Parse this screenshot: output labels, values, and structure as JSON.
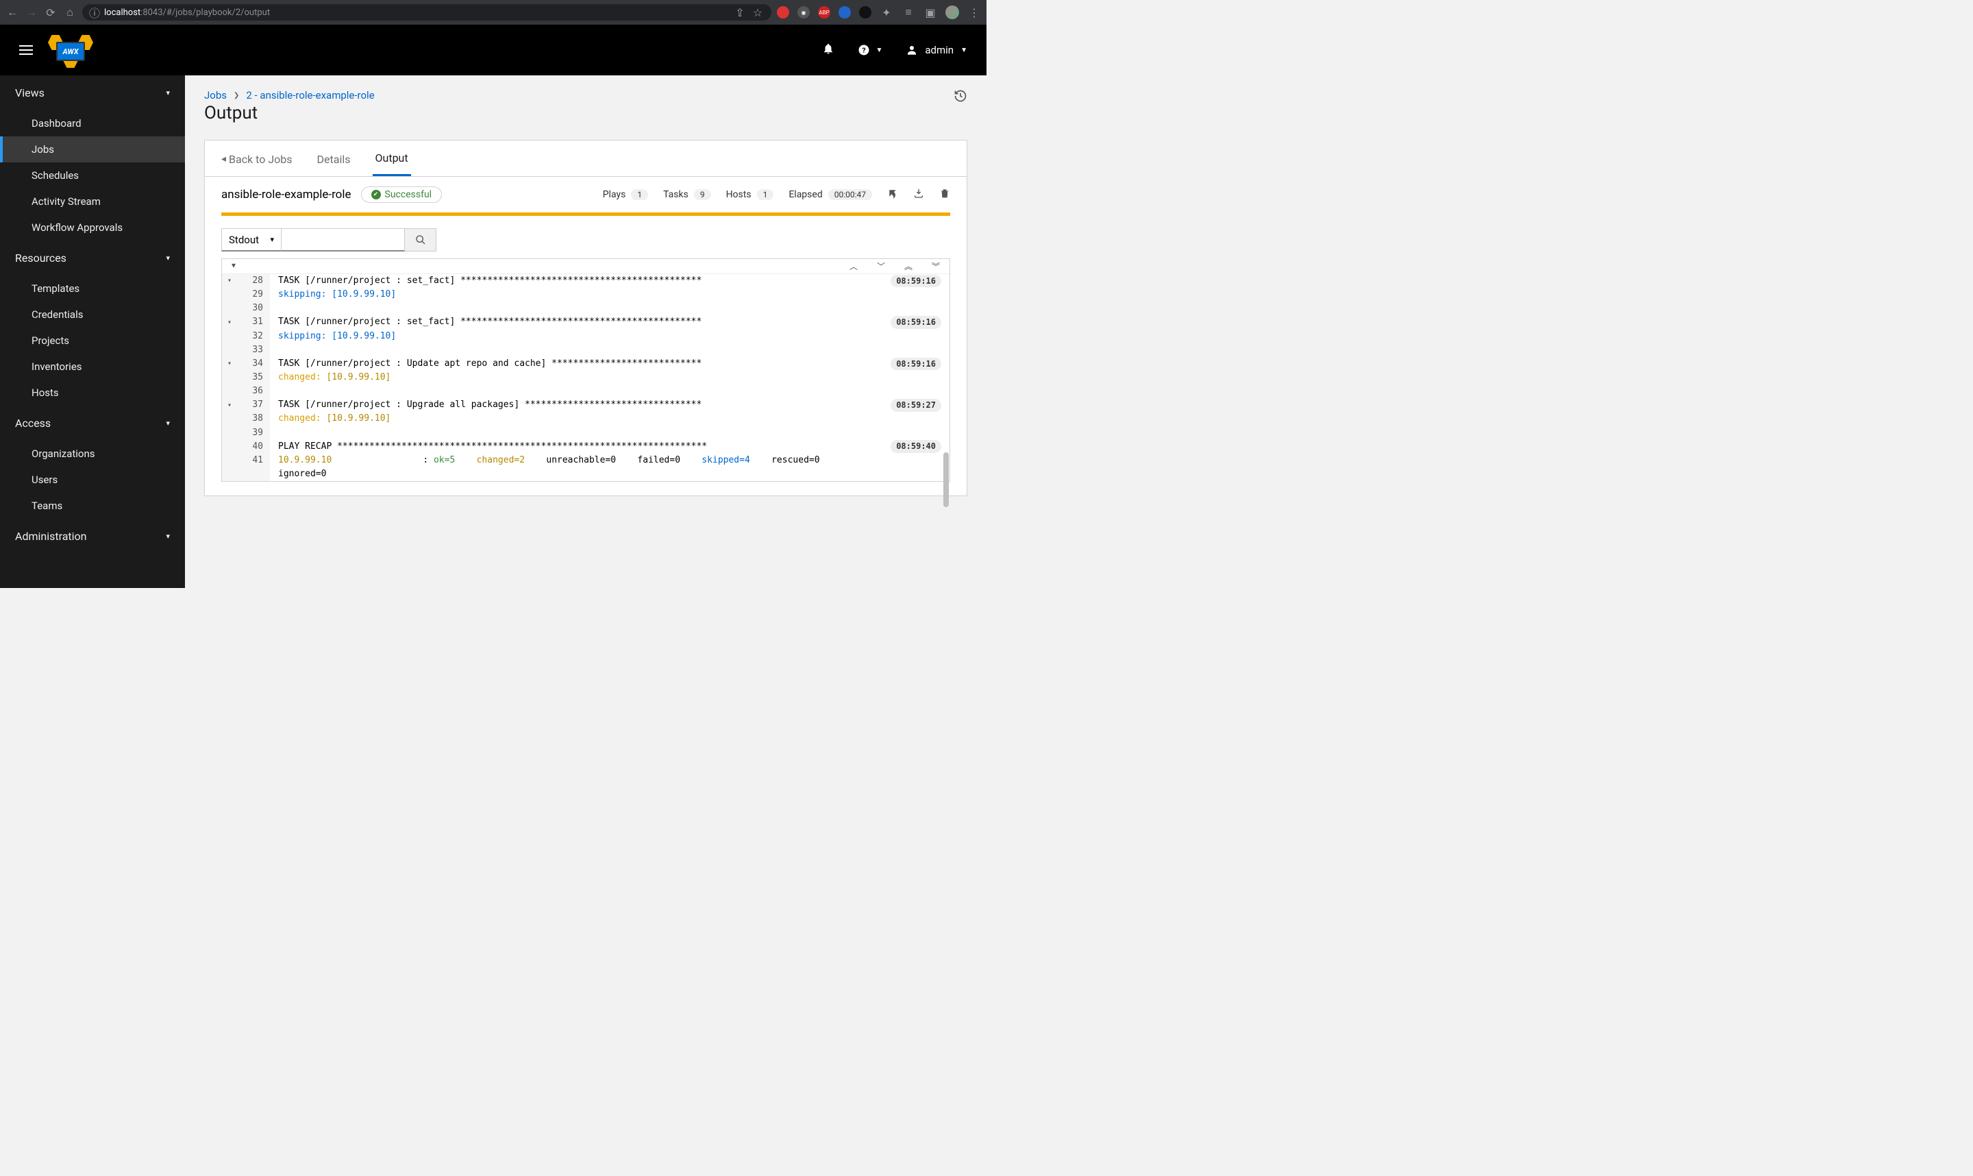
{
  "browser": {
    "url_host": "localhost",
    "url_port": ":8043",
    "url_path": "/#/jobs/playbook/2/output"
  },
  "topbar": {
    "logo_text": "AWX",
    "user_name": "admin"
  },
  "sidebar": {
    "sections": [
      {
        "label": "Views",
        "items": [
          "Dashboard",
          "Jobs",
          "Schedules",
          "Activity Stream",
          "Workflow Approvals"
        ],
        "active": "Jobs"
      },
      {
        "label": "Resources",
        "items": [
          "Templates",
          "Credentials",
          "Projects",
          "Inventories",
          "Hosts"
        ]
      },
      {
        "label": "Access",
        "items": [
          "Organizations",
          "Users",
          "Teams"
        ]
      },
      {
        "label": "Administration",
        "items": []
      }
    ]
  },
  "breadcrumb": {
    "root": "Jobs",
    "current": "2 - ansible-role-example-role"
  },
  "page_title": "Output",
  "tabs": {
    "back": "Back to Jobs",
    "details": "Details",
    "output": "Output"
  },
  "job": {
    "name": "ansible-role-example-role",
    "status": "Successful",
    "plays_label": "Plays",
    "plays": "1",
    "tasks_label": "Tasks",
    "tasks": "9",
    "hosts_label": "Hosts",
    "hosts": "1",
    "elapsed_label": "Elapsed",
    "elapsed": "00:00:47"
  },
  "filter": {
    "mode": "Stdout"
  },
  "log": {
    "lines": [
      {
        "n": "28",
        "chev": true,
        "text": "TASK [/runner/project : set_fact] *********************************************",
        "ts": "08:59:16"
      },
      {
        "n": "29",
        "parts": [
          {
            "t": "skipping: ",
            "c": "t-skiplabel"
          },
          {
            "t": "[10.9.99.10]",
            "c": "t-skip"
          }
        ]
      },
      {
        "n": "30",
        "text": ""
      },
      {
        "n": "31",
        "chev": true,
        "text": "TASK [/runner/project : set_fact] *********************************************",
        "ts": "08:59:16"
      },
      {
        "n": "32",
        "parts": [
          {
            "t": "skipping: ",
            "c": "t-skiplabel"
          },
          {
            "t": "[10.9.99.10]",
            "c": "t-skip"
          }
        ]
      },
      {
        "n": "33",
        "text": ""
      },
      {
        "n": "34",
        "chev": true,
        "text": "TASK [/runner/project : Update apt repo and cache] ****************************",
        "ts": "08:59:16"
      },
      {
        "n": "35",
        "parts": [
          {
            "t": "changed: ",
            "c": "t-changed-lbl"
          },
          {
            "t": "[10.9.99.10]",
            "c": "t-changed-host"
          }
        ]
      },
      {
        "n": "36",
        "text": ""
      },
      {
        "n": "37",
        "chev": true,
        "text": "TASK [/runner/project : Upgrade all packages] *********************************",
        "ts": "08:59:27"
      },
      {
        "n": "38",
        "parts": [
          {
            "t": "changed: ",
            "c": "t-changed-lbl"
          },
          {
            "t": "[10.9.99.10]",
            "c": "t-changed-host"
          }
        ]
      },
      {
        "n": "39",
        "text": ""
      },
      {
        "n": "40",
        "text": "PLAY RECAP *********************************************************************",
        "ts": "08:59:40"
      },
      {
        "n": "41",
        "parts": [
          {
            "t": "10.9.99.10                 ",
            "c": "t-host"
          },
          {
            "t": ": ",
            "c": ""
          },
          {
            "t": "ok=5",
            "c": "t-ok"
          },
          {
            "t": "    ",
            "c": ""
          },
          {
            "t": "changed=2",
            "c": "t-change"
          },
          {
            "t": "    unreachable=0    failed=0    ",
            "c": ""
          },
          {
            "t": "skipped=4",
            "c": "t-skipped"
          },
          {
            "t": "    rescued=0   ",
            "c": ""
          }
        ]
      },
      {
        "n": "",
        "text": "ignored=0"
      }
    ]
  }
}
